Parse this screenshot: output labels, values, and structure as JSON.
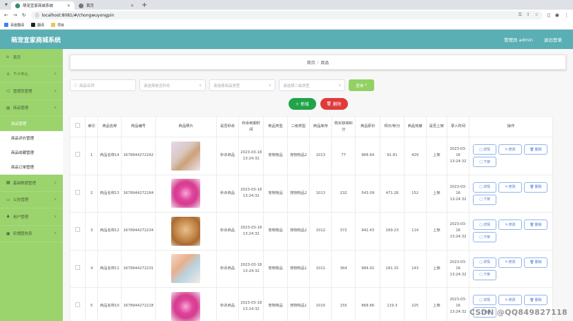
{
  "browser": {
    "tabs": [
      {
        "label": "萌宠宜家商城系统",
        "active": true
      },
      {
        "label": "首页",
        "active": false
      }
    ],
    "url": "localhost:8081/#/chongwuyongpin",
    "bookmarks": [
      "百度翻译",
      "翻译",
      "项目"
    ]
  },
  "header": {
    "title": "萌宠宜家商城系统",
    "user": "管理员 admin",
    "logout": "退出登录"
  },
  "sidebar": {
    "items": [
      {
        "label": "首页",
        "icon": "home-icon",
        "type": "top"
      },
      {
        "label": "个人中心",
        "icon": "user-icon",
        "type": "top"
      },
      {
        "label": "管理员管理",
        "icon": "admin-icon",
        "type": "top"
      },
      {
        "label": "商品管理",
        "icon": "goods-icon",
        "type": "top"
      },
      {
        "label": "商品管理",
        "type": "sub",
        "active": true
      },
      {
        "label": "商品评价管理",
        "type": "sub"
      },
      {
        "label": "商品收藏管理",
        "type": "sub"
      },
      {
        "label": "商品订单管理",
        "type": "sub"
      },
      {
        "label": "基础数据管理",
        "icon": "data-icon",
        "type": "top"
      },
      {
        "label": "公告管理",
        "icon": "notice-icon",
        "type": "top"
      },
      {
        "label": "用户管理",
        "icon": "users-icon",
        "type": "top"
      },
      {
        "label": "轮播图信息",
        "icon": "banner-icon",
        "type": "top"
      }
    ]
  },
  "breadcrumb": {
    "home": "首页",
    "sep": "/",
    "current": "商品"
  },
  "filters": {
    "name_placeholder": "商品名称",
    "type1_placeholder": "请选择是否秒杀",
    "type2_placeholder": "请选择商品类型",
    "type3_placeholder": "请选择二级类型",
    "search_label": "查询"
  },
  "actions": {
    "add_label": "新增",
    "delete_label": "删除"
  },
  "table": {
    "headers": [
      "索引",
      "商品名称",
      "商品编号",
      "商品照片",
      "是否秒杀",
      "秒杀到期时间",
      "商品类型",
      "二级类型",
      "商品库存",
      "购买获得积分",
      "商品原价",
      "现价/积分",
      "商品热度",
      "是否上架",
      "录入时间",
      "操作"
    ],
    "rows": [
      {
        "index": "1",
        "name": "商品名称14",
        "code": "1678944272242",
        "seckill": "秒杀商品",
        "expire": "2023-03-18 13:24:32",
        "type": "宠物物品",
        "subtype": "宠物物品2",
        "stock": "1013",
        "points": "77",
        "price": "968.64",
        "now": "91.81",
        "heat": "429",
        "onsale": "上架",
        "created": "2023-03-16 13:24:32"
      },
      {
        "index": "2",
        "name": "商品名称13",
        "code": "1678944272184",
        "seckill": "秒杀商品",
        "expire": "2023-03-18 13:24:32",
        "type": "宠物物品",
        "subtype": "宠物物品2",
        "stock": "1013",
        "points": "232",
        "price": "543.09",
        "now": "471.28",
        "heat": "152",
        "onsale": "上架",
        "created": "2023-03-16 13:24:32"
      },
      {
        "index": "3",
        "name": "商品名称12",
        "code": "1678944272234",
        "seckill": "秒杀商品",
        "expire": "2023-03-18 13:24:32",
        "type": "宠物物品",
        "subtype": "宠物物品2",
        "stock": "1012",
        "points": "372",
        "price": "942.43",
        "now": "169.23",
        "heat": "114",
        "onsale": "上架",
        "created": "2023-03-16 13:24:32"
      },
      {
        "index": "4",
        "name": "商品名称11",
        "code": "1678944272231",
        "seckill": "秒杀商品",
        "expire": "2023-03-18 13:24:32",
        "type": "宠物物品",
        "subtype": "宠物物品1",
        "stock": "1011",
        "points": "364",
        "price": "984.02",
        "now": "181.15",
        "heat": "143",
        "onsale": "上架",
        "created": "2023-03-16 13:24:32"
      },
      {
        "index": "5",
        "name": "商品名称10",
        "code": "1678944272218",
        "seckill": "秒杀商品",
        "expire": "2023-03-18 13:24:32",
        "type": "宠物物品",
        "subtype": "宠物物品1",
        "stock": "1010",
        "points": "155",
        "price": "868.66",
        "now": "119.3",
        "heat": "225",
        "onsale": "上架",
        "created": "2023-03-16 13:24:32"
      }
    ],
    "op_labels": {
      "detail": "详情",
      "edit": "修改",
      "delete": "删除",
      "off": "下架"
    }
  },
  "watermark": "CSDN @QQ849827118",
  "colors": {
    "header": "#5aafb4",
    "sidebar": "#9bd36d",
    "add": "#21a349",
    "delete": "#e03a3a"
  }
}
